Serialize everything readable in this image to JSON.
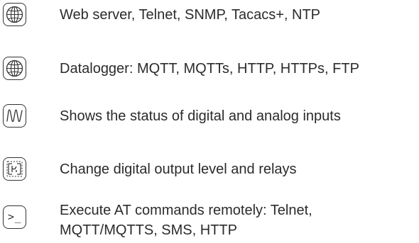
{
  "features": [
    {
      "icon": "globe-icon",
      "text": "Web server, Telnet, SNMP, Tacacs+, NTP"
    },
    {
      "icon": "globe-icon",
      "text": "Datalogger: MQTT, MQTTs, HTTP, HTTPs, FTP"
    },
    {
      "icon": "waveform-icon",
      "text": "Shows the status of digital and analog inputs"
    },
    {
      "icon": "relay-icon",
      "text": "Change digital output level and relays"
    },
    {
      "icon": "terminal-icon",
      "icon_glyph": ">_",
      "text_line1": "Execute AT commands remotely:   Telnet,",
      "text_line2": "MQTT/MQTTS, SMS, HTTP"
    }
  ],
  "colors": {
    "text": "#2b2b2b",
    "icon_stroke": "#333333",
    "background": "#ffffff"
  }
}
